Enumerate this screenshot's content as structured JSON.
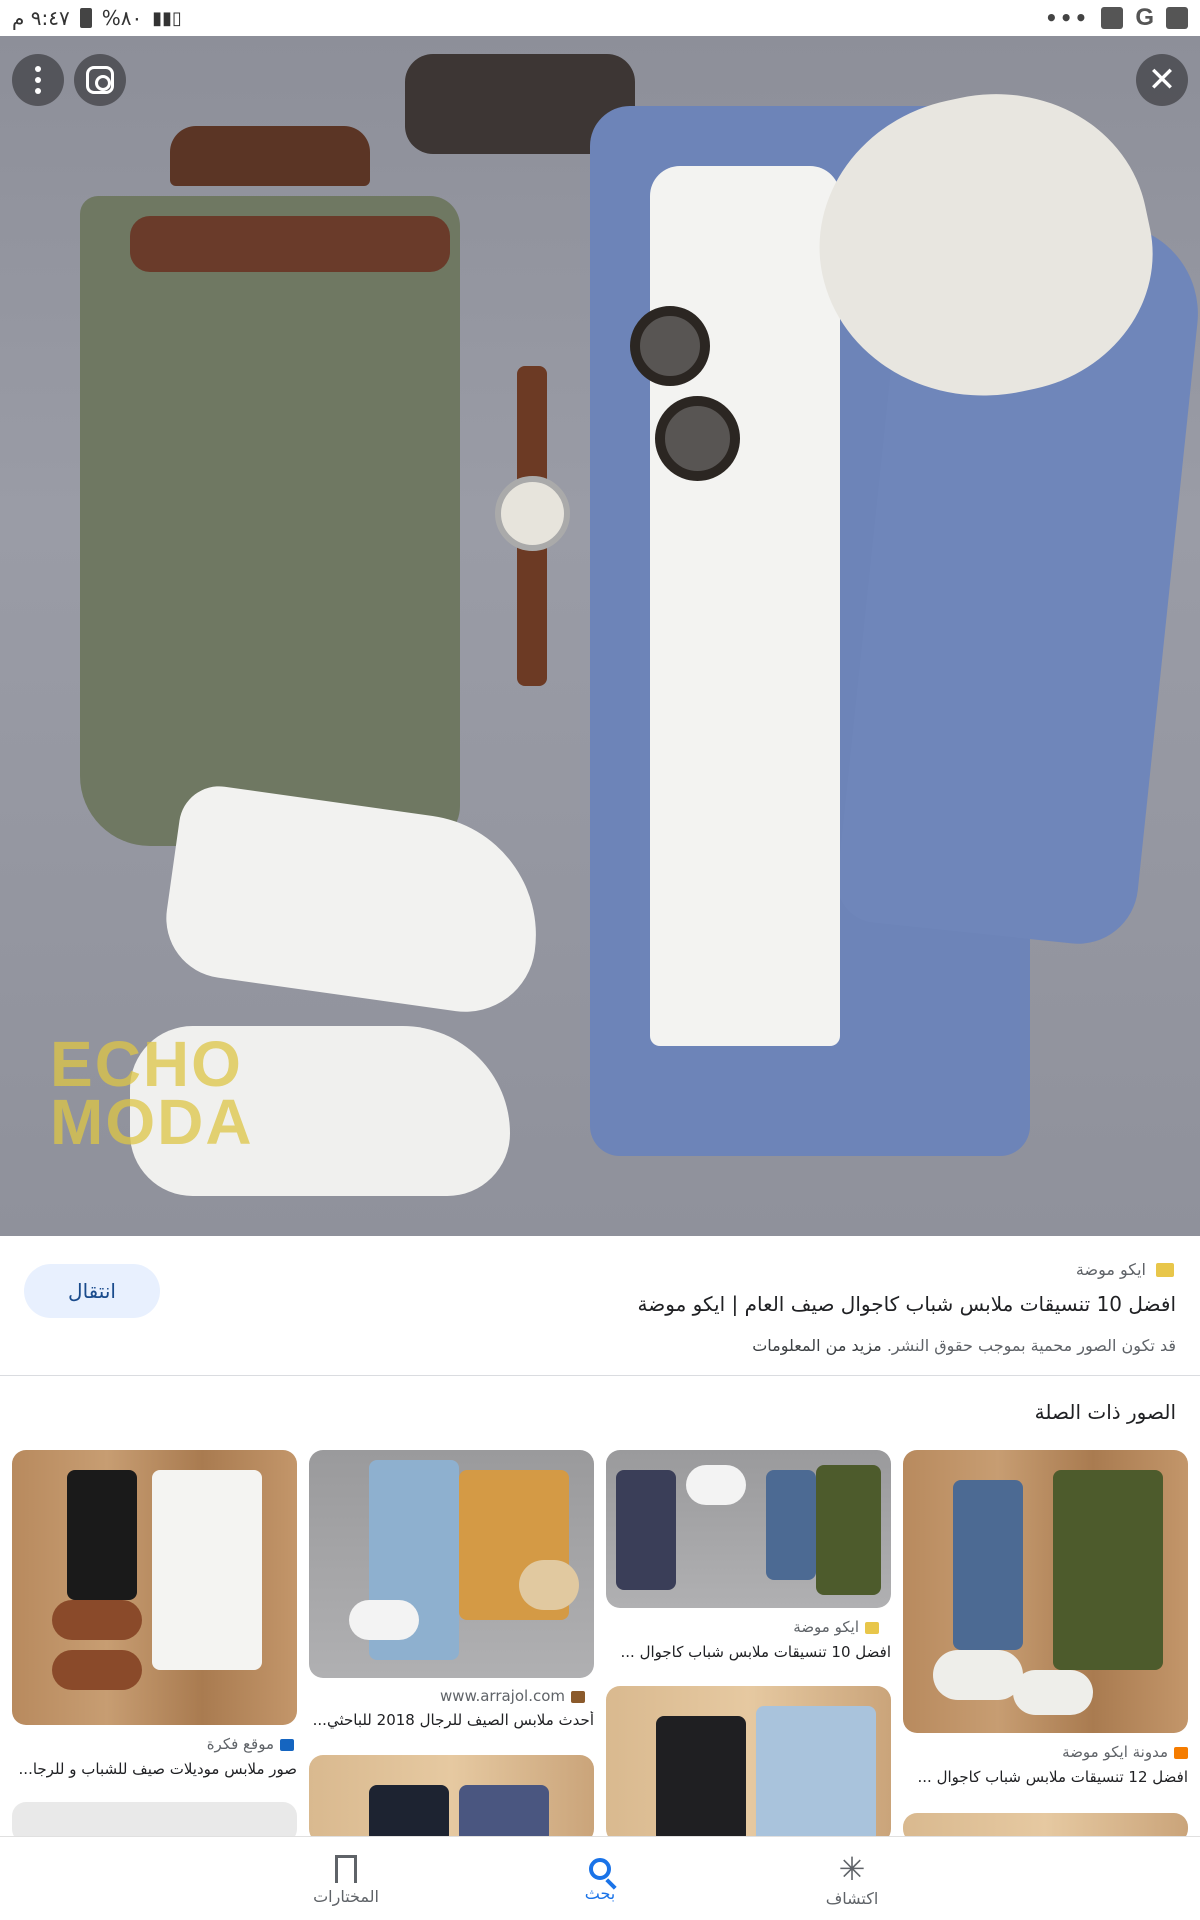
{
  "status_bar": {
    "time": "٩:٤٧ م",
    "battery": "%٨٠",
    "menu_dots": "•••"
  },
  "viewer": {
    "watermark_line1": "ECHO",
    "watermark_line2": "MODA",
    "close_glyph": "✕"
  },
  "result": {
    "source": "ايكو موضة",
    "title": "افضل 10 تنسيقات ملابس شباب كاجوال صيف العام | ايكو موضة",
    "copyright_notice": "قد تكون الصور محمية بموجب حقوق النشر.",
    "more_info": "مزيد من المعلومات",
    "visit_button": "انتقال"
  },
  "related": {
    "header": "الصور ذات الصلة",
    "items": [
      {
        "source": "مدونة ايكو موضة",
        "title": "افضل 12 تنسيقات ملابس شباب كاجوال ..."
      },
      {
        "source": "ايكو موضة",
        "title": "افضل 10 تنسيقات ملابس شباب كاجوال ..."
      },
      {
        "source": "www.arrajol.com",
        "title": "أحدث ملابس الصيف للرجال 2018 للباحثي..."
      },
      {
        "source": "موقع فكرة",
        "title": "صور ملابس موديلات صيف للشباب و للرجا..."
      }
    ]
  },
  "bottom_nav": {
    "discover": "اكتشاف",
    "search": "بحث",
    "collections": "المختارات"
  },
  "colors": {
    "accent": "#1a73e8",
    "button_bg": "#e8f0fe"
  }
}
